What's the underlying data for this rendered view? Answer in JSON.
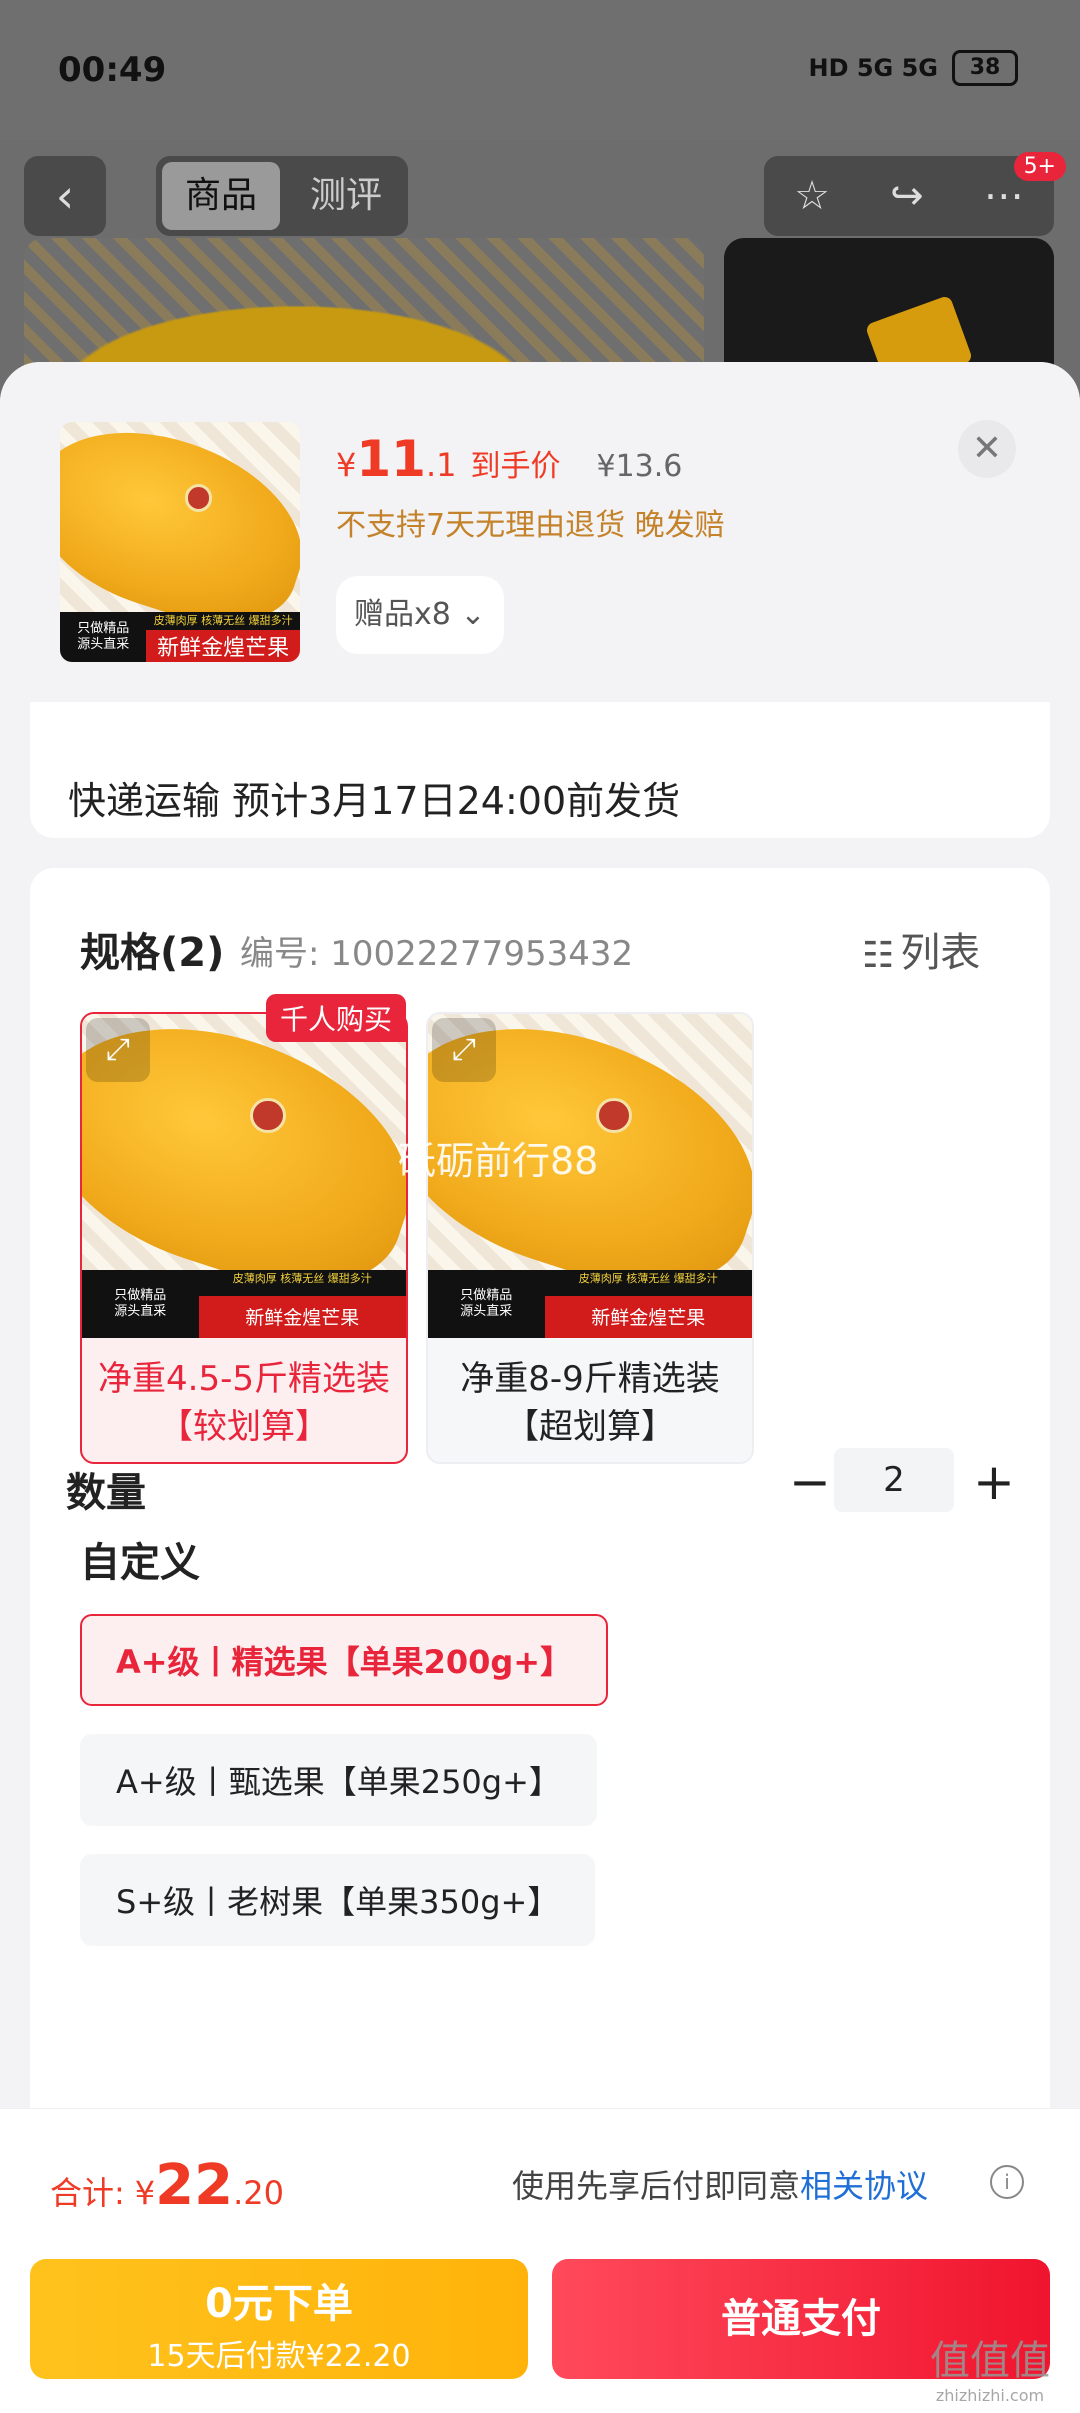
{
  "status": {
    "time": "00:49",
    "signal": "HD 5G 5G",
    "battery": "38"
  },
  "background": {
    "tab_goods": "商品",
    "tab_review": "测评",
    "badge": "5+"
  },
  "sheet": {
    "price": {
      "currency": "¥",
      "int": "11",
      "dec": ".1",
      "tag": "到手价",
      "original": "¥13.6"
    },
    "notice": "不支持7天无理由退货  晚发赔",
    "gift": "赠品x8",
    "shipping": "快递运输 预计3月17日24:00前发货",
    "spec": {
      "title": "规格(2)",
      "code": "编号: 10022277953432",
      "list_label": "列表",
      "badge": "千人购买",
      "watermark": "砥砺前行88",
      "image_captions": {
        "left_top": "只做精品",
        "left_bottom": "源头直采",
        "right_top": "皮薄肉厚 核薄无丝 爆甜多汁",
        "right_bottom": "新鲜金煌芒果"
      },
      "options": [
        {
          "label": "净重4.5-5斤精选装【较划算】",
          "selected": true
        },
        {
          "label": "净重8-9斤精选装【超划算】",
          "selected": false
        }
      ]
    },
    "custom": {
      "title": "自定义",
      "options": [
        {
          "label": "A+级丨精选果【单果200g+】",
          "selected": true
        },
        {
          "label": "A+级丨甄选果【单果250g+】",
          "selected": false
        },
        {
          "label": "S+级丨老树果【单果350g+】",
          "selected": false
        }
      ]
    },
    "quantity": {
      "title": "数量",
      "value": "2"
    }
  },
  "footer": {
    "total_label": "合计:",
    "total_currency": "¥",
    "total_int": "22",
    "total_dec": ".20",
    "agree_text": "使用先享后付即同意",
    "agree_link": "相关协议",
    "pay_later_title": "0元下单",
    "pay_later_sub": "15天后付款¥22.20",
    "pay_now": "普通支付"
  },
  "watermark": {
    "main": "值值值",
    "sub": "zhizhizhi.com"
  },
  "colors": {
    "accent": "#e8253a",
    "price": "#ef3b26",
    "notice": "#c4822a",
    "pay_later": "#ffb30a",
    "link": "#1f6fd6"
  }
}
